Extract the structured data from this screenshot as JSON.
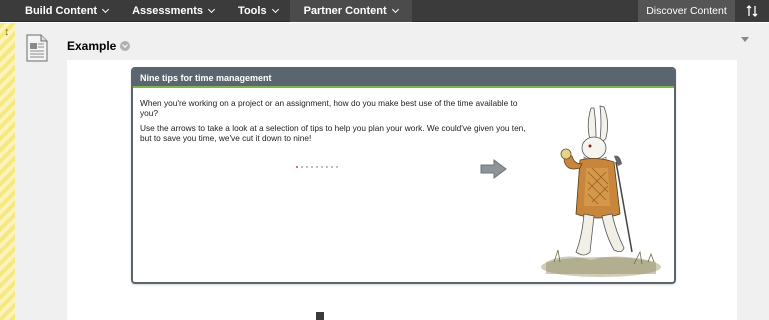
{
  "toolbar": {
    "build_content": "Build Content",
    "assessments": "Assessments",
    "tools": "Tools",
    "partner_content": "Partner Content",
    "discover_content": "Discover Content",
    "sort_icon": "sort-arrows-icon"
  },
  "item": {
    "title": "Example",
    "icon": "document-icon"
  },
  "card": {
    "title": "Nine tips for time management",
    "paragraph1": "When you're working on a project or an assignment, how do you make best use of the time available to you?",
    "paragraph2": "Use the arrows to take a look at a selection of tips to help you plan your work. We could've given you ten, but to save you time, we've cut it down to nine!",
    "pagination": {
      "current": 1,
      "total": 9
    },
    "next_icon": "arrow-right-icon",
    "accent_color": "#7ab648",
    "header_color": "#5b6570"
  }
}
